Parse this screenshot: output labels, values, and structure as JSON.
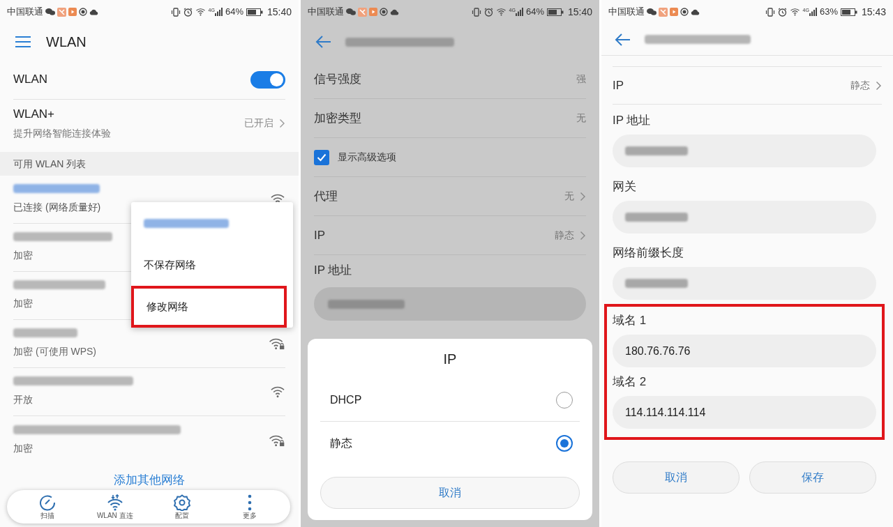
{
  "wlan_screen": {
    "status_bar": {
      "carrier": "中国联通",
      "network_type": "4G",
      "battery": "64%",
      "time": "15:40"
    },
    "title": "WLAN",
    "wlan_toggle": {
      "label": "WLAN",
      "on": true
    },
    "wlan_plus": {
      "label": "WLAN+",
      "subtitle": "提升网络智能连接体验",
      "value": "已开启"
    },
    "section_title": "可用 WLAN 列表",
    "networks": [
      {
        "status": "已连接 (网络质量好)",
        "connected": true,
        "kind": "open"
      },
      {
        "status": "加密",
        "connected": false,
        "kind": "covered"
      },
      {
        "status": "加密",
        "connected": false,
        "kind": "covered"
      },
      {
        "status": "加密 (可使用 WPS)",
        "connected": false,
        "kind": "secured"
      },
      {
        "status": "开放",
        "connected": false,
        "kind": "open"
      },
      {
        "status": "加密",
        "connected": false,
        "kind": "secured"
      }
    ],
    "add_network": "添加其他网络",
    "popup_menu": {
      "items": [
        {
          "label": "不保存网络",
          "highlighted": false
        },
        {
          "label": "修改网络",
          "highlighted": true
        }
      ]
    },
    "bottom_nav": [
      {
        "kind": "scan",
        "label": "扫描"
      },
      {
        "kind": "direct",
        "label": "WLAN 直连"
      },
      {
        "kind": "settings",
        "label": "配置"
      },
      {
        "kind": "more",
        "label": "更多"
      }
    ]
  },
  "detail_screen": {
    "status_bar": {
      "carrier": "中国联通",
      "network_type": "4G",
      "battery": "64%",
      "time": "15:40"
    },
    "rows": [
      {
        "kind": "value",
        "label": "信号强度",
        "value": "强"
      },
      {
        "kind": "value",
        "label": "加密类型",
        "value": "无"
      },
      {
        "kind": "checkbox",
        "label": "显示高级选项",
        "checked": true
      },
      {
        "kind": "link",
        "label": "代理",
        "value": "无"
      },
      {
        "kind": "link",
        "label": "IP",
        "value": "静态"
      },
      {
        "kind": "field",
        "label": "IP 地址"
      }
    ],
    "dialog": {
      "title": "IP",
      "options": [
        {
          "label": "DHCP",
          "selected": false
        },
        {
          "label": "静态",
          "selected": true
        }
      ],
      "cancel": "取消"
    }
  },
  "edit_screen": {
    "status_bar": {
      "carrier": "中国联通",
      "network_type": "4G",
      "battery": "63%",
      "time": "15:43"
    },
    "rows": [
      {
        "kind": "link",
        "label": "IP",
        "value": "静态"
      },
      {
        "kind": "field",
        "label": "IP 地址"
      },
      {
        "kind": "field",
        "label": "网关"
      },
      {
        "kind": "field",
        "label": "网络前缀长度"
      },
      {
        "kind": "field",
        "label": "域名 1",
        "value": "180.76.76.76",
        "highlighted": true
      },
      {
        "kind": "field",
        "label": "域名 2",
        "value": "114.114.114.114",
        "highlighted": true
      }
    ],
    "buttons": [
      "取消",
      "保存"
    ]
  }
}
